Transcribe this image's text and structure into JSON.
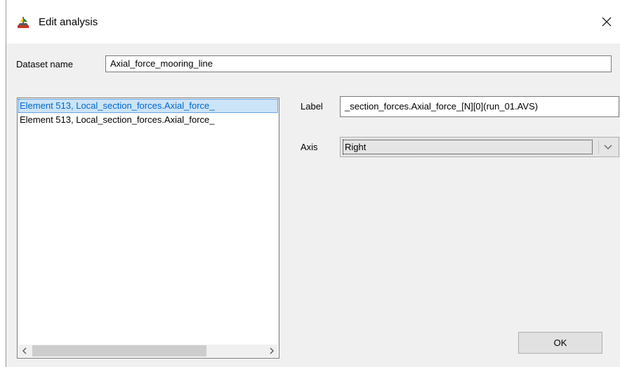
{
  "window": {
    "title": "Edit analysis",
    "app_icon": "ship-icon",
    "close_icon": "close-icon"
  },
  "dataset": {
    "label": "Dataset name",
    "value": "Axial_force_mooring_line"
  },
  "list": {
    "items": [
      "Element 513, Local_section_forces.Axial_force_",
      "Element 513, Local_section_forces.Axial_force_"
    ],
    "selected_index": 0,
    "scroll_left_icon": "chevron-left-icon",
    "scroll_right_icon": "chevron-right-icon"
  },
  "fields": {
    "label_caption": "Label",
    "label_value": "_section_forces.Axial_force_[N][0](run_01.AVS)",
    "axis_caption": "Axis",
    "axis_value": "Right",
    "axis_dropdown_icon": "chevron-down-icon"
  },
  "buttons": {
    "ok": "OK"
  },
  "colors": {
    "selection_bg": "#cce4f7",
    "selection_text": "#0066cc",
    "client_bg": "#f0f0f0"
  }
}
